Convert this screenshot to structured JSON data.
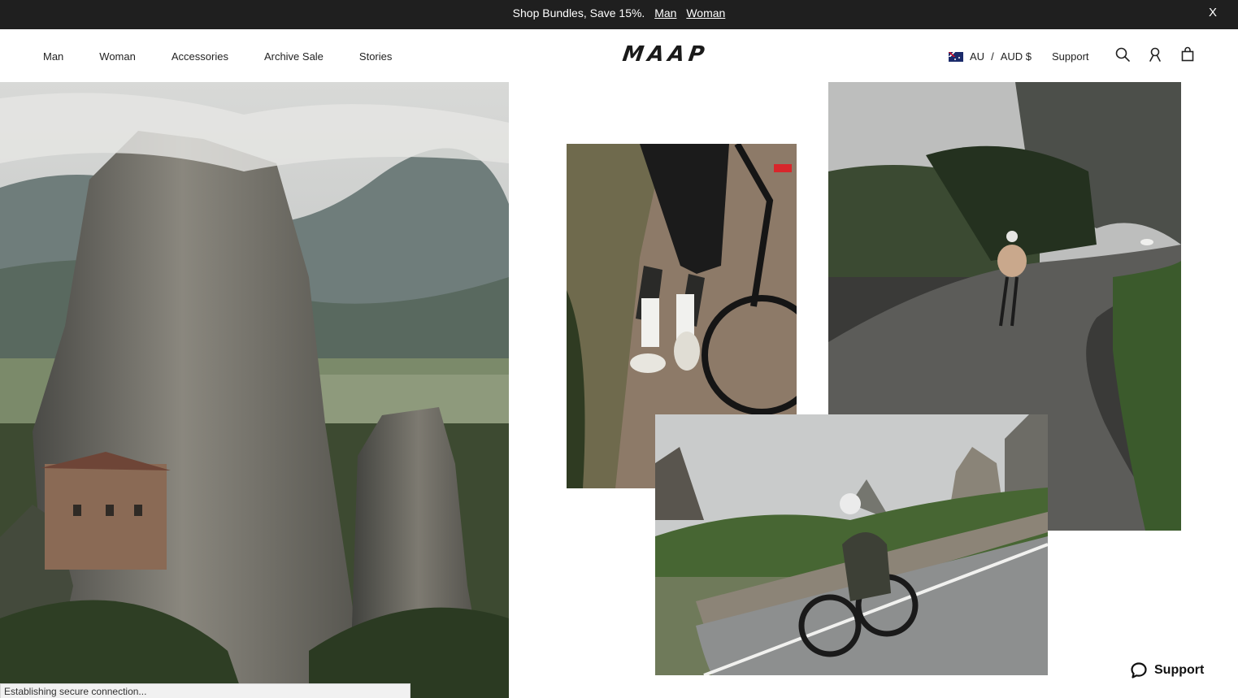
{
  "announcement": {
    "text": "Shop Bundles, Save 15%.",
    "link_man": "Man",
    "link_woman": "Woman",
    "close_label": "X"
  },
  "header": {
    "nav": [
      "Man",
      "Woman",
      "Accessories",
      "Archive Sale",
      "Stories"
    ],
    "logo": "MAAP",
    "locale": {
      "country": "AU",
      "separator": "/",
      "currency": "AUD $"
    },
    "support_label": "Support",
    "icons": [
      "search-icon",
      "account-icon",
      "cart-icon"
    ]
  },
  "status_bar": {
    "text": "Establishing secure connection..."
  },
  "chat_widget": {
    "label": "Support"
  },
  "colors": {
    "announcement_bg": "#1f1f1f",
    "page_bg": "#ffffff",
    "text": "#222222"
  }
}
